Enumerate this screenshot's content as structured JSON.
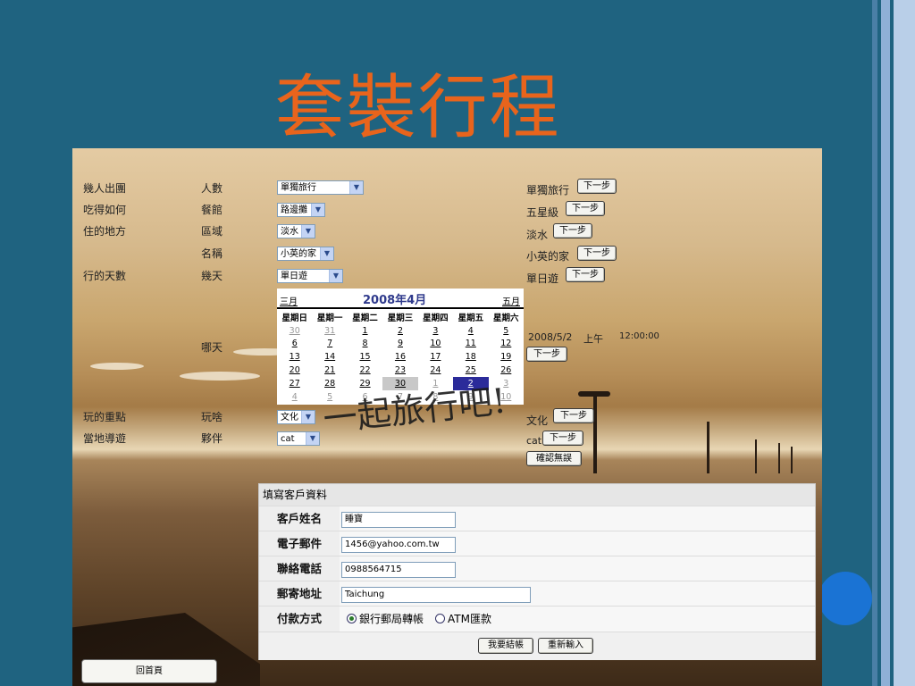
{
  "slide_title": "套裝行程",
  "rows": [
    {
      "label": "幾人出團",
      "field": "人數",
      "select": "單獨旅行",
      "result": "單獨旅行",
      "next": "下一步"
    },
    {
      "label": "吃得如何",
      "field": "餐館",
      "select": "路邊攤",
      "result": "五星級",
      "next": "下一步"
    },
    {
      "label": "住的地方",
      "field": "區域",
      "select": "淡水",
      "result": "淡水",
      "next": "下一步"
    },
    {
      "label": "",
      "field": "名稱",
      "select": "小英的家",
      "result": "小英的家",
      "next": "下一步"
    },
    {
      "label": "行的天數",
      "field": "幾天",
      "select": "單日遊",
      "result": "單日遊",
      "next": "下一步"
    }
  ],
  "which_day": {
    "field": "哪天",
    "result_date": "2008/5/2",
    "result_ampm": "上午",
    "result_time": "12:00:00",
    "next": "下一步"
  },
  "calendar": {
    "prev": "三月",
    "title": "2008年4月",
    "next": "五月",
    "weekdays": [
      "星期日",
      "星期一",
      "星期二",
      "星期三",
      "星期四",
      "星期五",
      "星期六"
    ],
    "weeks": [
      [
        "30",
        "31",
        "1",
        "2",
        "3",
        "4",
        "5"
      ],
      [
        "6",
        "7",
        "8",
        "9",
        "10",
        "11",
        "12"
      ],
      [
        "13",
        "14",
        "15",
        "16",
        "17",
        "18",
        "19"
      ],
      [
        "20",
        "21",
        "22",
        "23",
        "24",
        "25",
        "26"
      ],
      [
        "27",
        "28",
        "29",
        "30",
        "1",
        "2",
        "3"
      ],
      [
        "4",
        "5",
        "6",
        "7",
        "8",
        "9",
        "10"
      ]
    ]
  },
  "fun": {
    "label": "玩的重點",
    "field": "玩啥",
    "select": "文化",
    "result": "文化",
    "next": "下一步"
  },
  "guide": {
    "label": "當地導遊",
    "field": "夥伴",
    "select": "cat",
    "result": "cat",
    "next": "下一步",
    "confirm": "確認無誤"
  },
  "watermark": "一起旅行吧!",
  "form": {
    "heading": "填寫客戶資料",
    "name_label": "客戶姓名",
    "name_value": "睡寶",
    "email_label": "電子郵件",
    "email_value": "1456@yahoo.com.tw",
    "phone_label": "聯絡電話",
    "phone_value": "0988564715",
    "address_label": "郵寄地址",
    "address_value": "Taichung",
    "pay_label": "付款方式",
    "pay_opt1": "銀行郵局轉帳",
    "pay_opt2": "ATM匯款",
    "checkout": "我要結帳",
    "reset": "重新輸入"
  },
  "home_button": "回首頁",
  "colors": {
    "background": "#1f6380",
    "title": "#e8641c",
    "accent_circle": "#1a73d4",
    "selected_day": "#2b2b9a"
  }
}
